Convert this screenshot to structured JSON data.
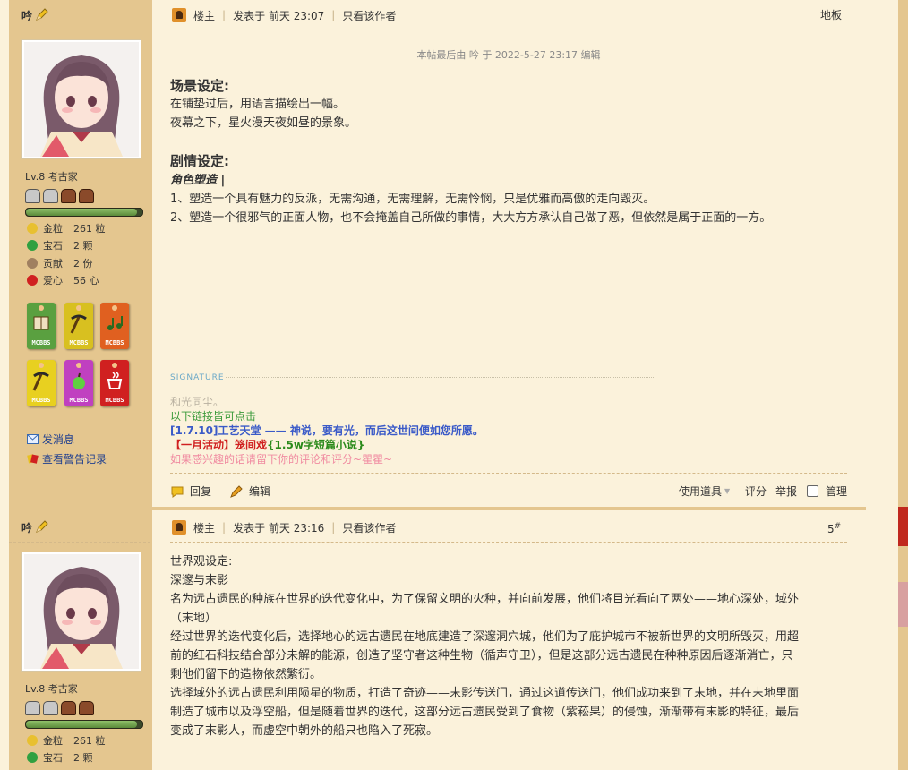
{
  "post1": {
    "author": "吟",
    "level": "Lv.8 考古家",
    "progress": 0.95,
    "stats": [
      {
        "label": "金粒",
        "value": "261 粒",
        "color": "#e8c030"
      },
      {
        "label": "宝石",
        "value": "2 颗",
        "color": "#30a040"
      },
      {
        "label": "贡献",
        "value": "2 份",
        "color": "#a08060"
      },
      {
        "label": "爱心",
        "value": "56 心",
        "color": "#d02020"
      }
    ],
    "medals": [
      {
        "icon": "book-icon",
        "text": "MCBBS",
        "color": "#5aa040"
      },
      {
        "icon": "pickaxe-icon",
        "text": "MCBBS",
        "color": "#d8c020"
      },
      {
        "icon": "music-icon",
        "text": "MCBBS",
        "color": "#e06020"
      },
      {
        "icon": "pickaxe-icon",
        "text": "MCBBS",
        "color": "#e8d020"
      },
      {
        "icon": "apple-icon",
        "text": "MCBBS",
        "color": "#c040c0"
      },
      {
        "icon": "java-icon",
        "text": "MCBBS",
        "color": "#d02020"
      }
    ],
    "links": {
      "message": "发消息",
      "warnings": "查看警告记录"
    },
    "header": {
      "louzhu": "楼主",
      "time": "发表于 前天 23:07",
      "only_author": "只看该作者",
      "floor": "地板"
    },
    "edit_note": "本帖最后由 吟 于 2022-5-27 23:17 编辑",
    "scene_title": "场景设定:",
    "scene_lines": [
      "在铺垫过后，用语言描绘出一幅。",
      "夜幕之下，星火漫天夜如昼的景象。"
    ],
    "plot_title": "剧情设定:",
    "role_title": "角色塑造 |",
    "plot_lines": [
      "1、塑造一个具有魅力的反派，无需沟通，无需理解，无需怜悯，只是优雅而高傲的走向毁灭。",
      "2、塑造一个很邪气的正面人物，也不会掩盖自己所做的事情，大大方方承认自己做了恶，但依然是属于正面的一方。"
    ],
    "signature_label": "SIGNATURE",
    "signature": {
      "line1": "和光同尘。",
      "line2": "以下链接皆可点击",
      "line3": "[1.7.10]工艺天堂 —— 神说，要有光，而后这世间便如您所愿。",
      "line4_red": "【一月活动】笼间戏",
      "line4_green": "{1.5w字短篇小说}",
      "line5": "如果感兴趣的话请留下你的评论和评分~瞿瞿~"
    },
    "footer": {
      "reply": "回复",
      "edit": "编辑",
      "tools": "使用道具",
      "rate": "评分",
      "report": "举报",
      "manage": "管理"
    }
  },
  "post2": {
    "author": "吟",
    "level": "Lv.8 考古家",
    "progress": 0.95,
    "stats": [
      {
        "label": "金粒",
        "value": "261 粒",
        "color": "#e8c030"
      },
      {
        "label": "宝石",
        "value": "2 颗",
        "color": "#30a040"
      }
    ],
    "header": {
      "louzhu": "楼主",
      "time": "发表于 前天 23:16",
      "only_author": "只看该作者",
      "floor": "5",
      "floor_mark": "#"
    },
    "lines": [
      "世界观设定:",
      "深邃与末影",
      "名为远古遗民的种族在世界的迭代变化中，为了保留文明的火种，并向前发展，他们将目光看向了两处——地心深处，域外",
      "（末地）",
      "经过世界的迭代变化后，选择地心的远古遗民在地底建造了深邃洞穴城，他们为了庇护城市不被新世界的文明所毁灭，用超",
      "前的红石科技结合部分未解的能源，创造了坚守者这种生物（循声守卫），但是这部分远古遗民在种种原因后逐渐消亡，只",
      "剩他们留下的造物依然繁衍。",
      "选择域外的远古遗民利用陨星的物质，打造了奇迹——末影传送门，通过这道传送门，他们成功来到了末地，并在末地里面",
      "制造了城市以及浮空船，但是随着世界的迭代，这部分远古遗民受到了食物（紫菘果）的侵蚀，渐渐带有末影的特征，最后",
      "变成了末影人，而虚空中朝外的船只也陷入了死寂。"
    ]
  }
}
